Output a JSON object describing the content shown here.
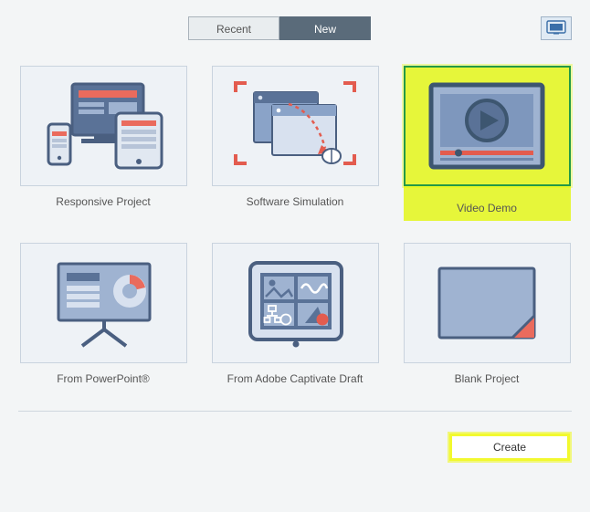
{
  "tabs": {
    "recent": "Recent",
    "new": "New"
  },
  "tiles": {
    "responsive": {
      "label": "Responsive Project"
    },
    "simulation": {
      "label": "Software Simulation"
    },
    "videodemo": {
      "label": "Video Demo"
    },
    "powerpoint": {
      "label": "From PowerPoint®"
    },
    "draft": {
      "label": "From Adobe Captivate Draft"
    },
    "blank": {
      "label": "Blank Project"
    }
  },
  "buttons": {
    "create": "Create"
  }
}
